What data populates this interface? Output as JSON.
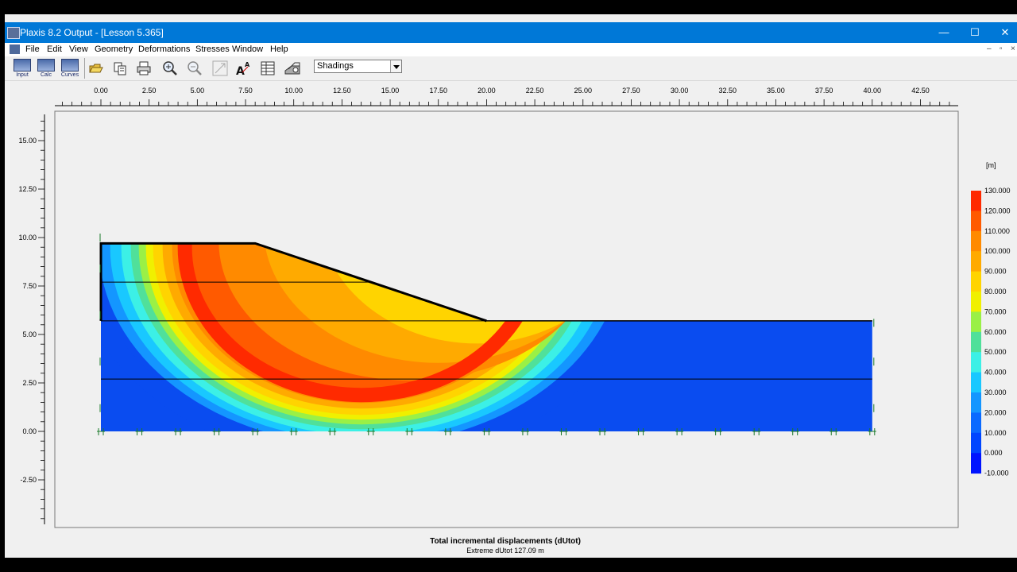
{
  "window": {
    "title": "Plaxis 8.2 Output - [Lesson 5.365]",
    "controls": [
      "—",
      "☐",
      "✕"
    ]
  },
  "menu": {
    "items": [
      "File",
      "Edit",
      "View",
      "Geometry",
      "Deformations",
      "Stresses",
      "Window",
      "Help"
    ],
    "mdi_controls": [
      "–",
      "▫",
      "×"
    ]
  },
  "toolbar": {
    "apps": [
      "Input",
      "Calc",
      "Curves"
    ],
    "icons": [
      "open-icon",
      "copy-icon",
      "print-icon",
      "zoom-in-icon",
      "zoom-out-icon",
      "reset-view-icon",
      "text-size-icon",
      "table-icon",
      "cross-section-icon"
    ],
    "view_select": {
      "value": "Shadings"
    }
  },
  "x_axis_ticks": [
    "0.00",
    "2.50",
    "5.00",
    "7.50",
    "10.00",
    "12.50",
    "15.00",
    "17.50",
    "20.00",
    "22.50",
    "25.00",
    "27.50",
    "30.00",
    "32.50",
    "35.00",
    "37.50",
    "40.00",
    "42.50"
  ],
  "y_axis_ticks": [
    "15.00",
    "12.50",
    "10.00",
    "7.50",
    "5.00",
    "2.50",
    "0.00",
    "-2.50"
  ],
  "legend": {
    "unit": "[m]",
    "levels": [
      "130.000",
      "120.000",
      "110.000",
      "100.000",
      "90.000",
      "80.000",
      "70.000",
      "60.000",
      "50.000",
      "40.000",
      "30.000",
      "20.000",
      "10.000",
      "0.000",
      "-10.000"
    ],
    "colors": [
      "#ff2a00",
      "#ff5a00",
      "#ff8a00",
      "#ffaa00",
      "#ffd400",
      "#f0f000",
      "#9af046",
      "#50e09a",
      "#3cf0e6",
      "#19c8ff",
      "#1496ff",
      "#0a6aff",
      "#0046ff",
      "#0014ff"
    ]
  },
  "caption": {
    "title": "Total incremental displacements (dUtot)",
    "subtitle": "Extreme dUtot 127.09 m"
  },
  "model": {
    "slope_crest_x": 8.0,
    "slope_toe_x": 20.0,
    "crest_y": 9.7,
    "toe_y": 5.7,
    "width_x": 40.0,
    "layer_y": [
      7.7,
      5.7,
      2.7
    ]
  }
}
